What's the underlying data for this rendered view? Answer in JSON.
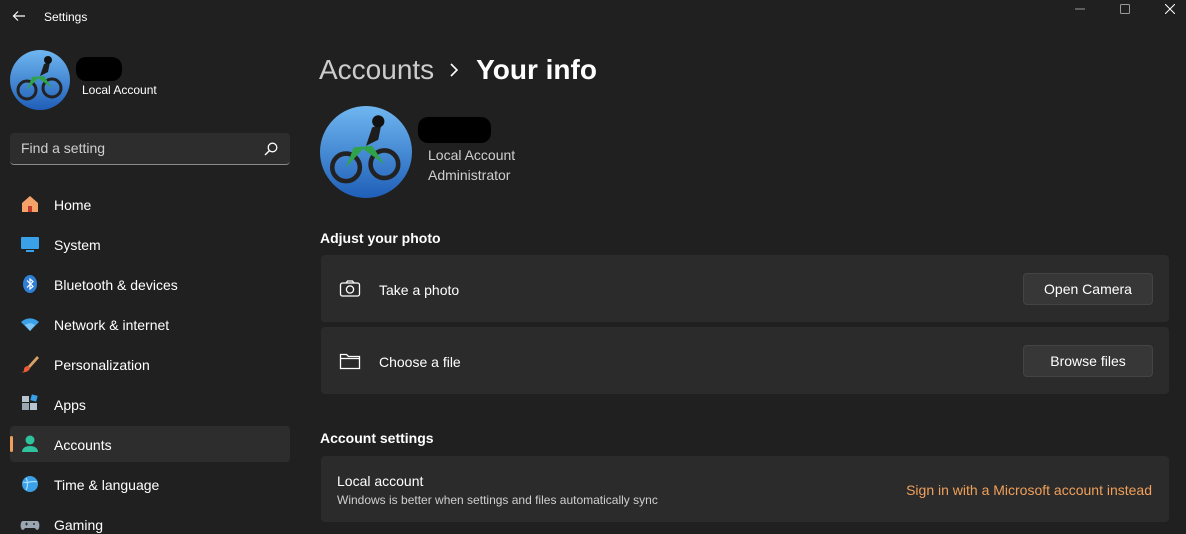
{
  "window": {
    "title": "Settings",
    "back_icon": "back-arrow-icon",
    "controls": [
      "minimize-icon",
      "maximize-icon",
      "close-icon"
    ]
  },
  "sidebar": {
    "profile": {
      "account_type": "Local Account"
    },
    "search": {
      "placeholder": "Find a setting",
      "value": ""
    },
    "items": [
      {
        "label": "Home",
        "icon": "home-icon",
        "active": false
      },
      {
        "label": "System",
        "icon": "system-icon",
        "active": false
      },
      {
        "label": "Bluetooth & devices",
        "icon": "bluetooth-icon",
        "active": false
      },
      {
        "label": "Network & internet",
        "icon": "network-icon",
        "active": false
      },
      {
        "label": "Personalization",
        "icon": "personalization-brush-icon",
        "active": false
      },
      {
        "label": "Apps",
        "icon": "apps-icon",
        "active": false
      },
      {
        "label": "Accounts",
        "icon": "accounts-icon",
        "active": true
      },
      {
        "label": "Time & language",
        "icon": "time-language-icon",
        "active": false
      },
      {
        "label": "Gaming",
        "icon": "gaming-icon",
        "active": false
      }
    ]
  },
  "main": {
    "breadcrumb": {
      "parent": "Accounts",
      "current": "Your info"
    },
    "user": {
      "account_type": "Local Account",
      "role": "Administrator"
    },
    "adjust_photo": {
      "title": "Adjust your photo",
      "take_photo": {
        "label": "Take a photo",
        "button": "Open Camera",
        "icon": "camera-icon"
      },
      "choose_file": {
        "label": "Choose a file",
        "button": "Browse files",
        "icon": "folder-icon"
      }
    },
    "account_settings": {
      "title": "Account settings",
      "local_account": {
        "title": "Local account",
        "description": "Windows is better when settings and files automatically sync",
        "link": "Sign in with a Microsoft account instead"
      }
    }
  },
  "colors": {
    "background": "#202020",
    "card": "#2b2b2b",
    "accent": "#f0a05a"
  }
}
